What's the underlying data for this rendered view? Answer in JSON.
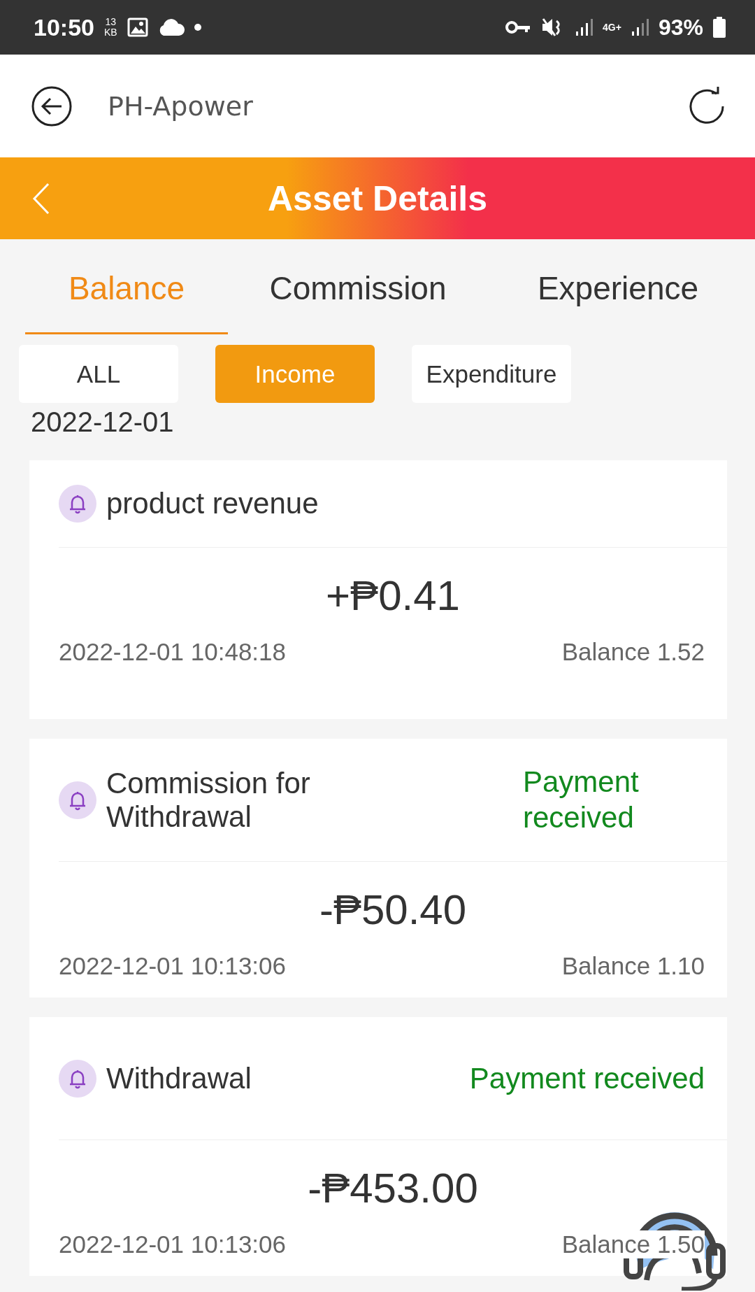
{
  "status_bar": {
    "time": "10:50",
    "data_rate": "13",
    "data_unit": "KB",
    "network": "4G+",
    "battery": "93%"
  },
  "app_bar": {
    "title": "PH-Apower"
  },
  "header": {
    "title": "Asset Details"
  },
  "tabs": [
    {
      "label": "Balance",
      "selected": true
    },
    {
      "label": "Commission",
      "selected": false
    },
    {
      "label": "Experience",
      "selected": false
    }
  ],
  "filters": [
    {
      "label": "ALL",
      "selected": false
    },
    {
      "label": "Income",
      "selected": true
    },
    {
      "label": "Expenditure",
      "selected": false
    }
  ],
  "date_heading": "2022-12-01",
  "records": [
    {
      "title": "product revenue",
      "amount": "+₱0.41",
      "time": "2022-12-01 10:48:18",
      "balance": "Balance 1.52"
    },
    {
      "title": "Commission for Withdrawal",
      "status": "Payment received",
      "amount": "-₱50.40",
      "time": "2022-12-01 10:13:06",
      "balance": "Balance 1.10"
    },
    {
      "title": "Withdrawal",
      "status": "Payment received",
      "amount": "-₱453.00",
      "time": "2022-12-01 10:13:06",
      "balance": "Balance 1.50"
    }
  ]
}
